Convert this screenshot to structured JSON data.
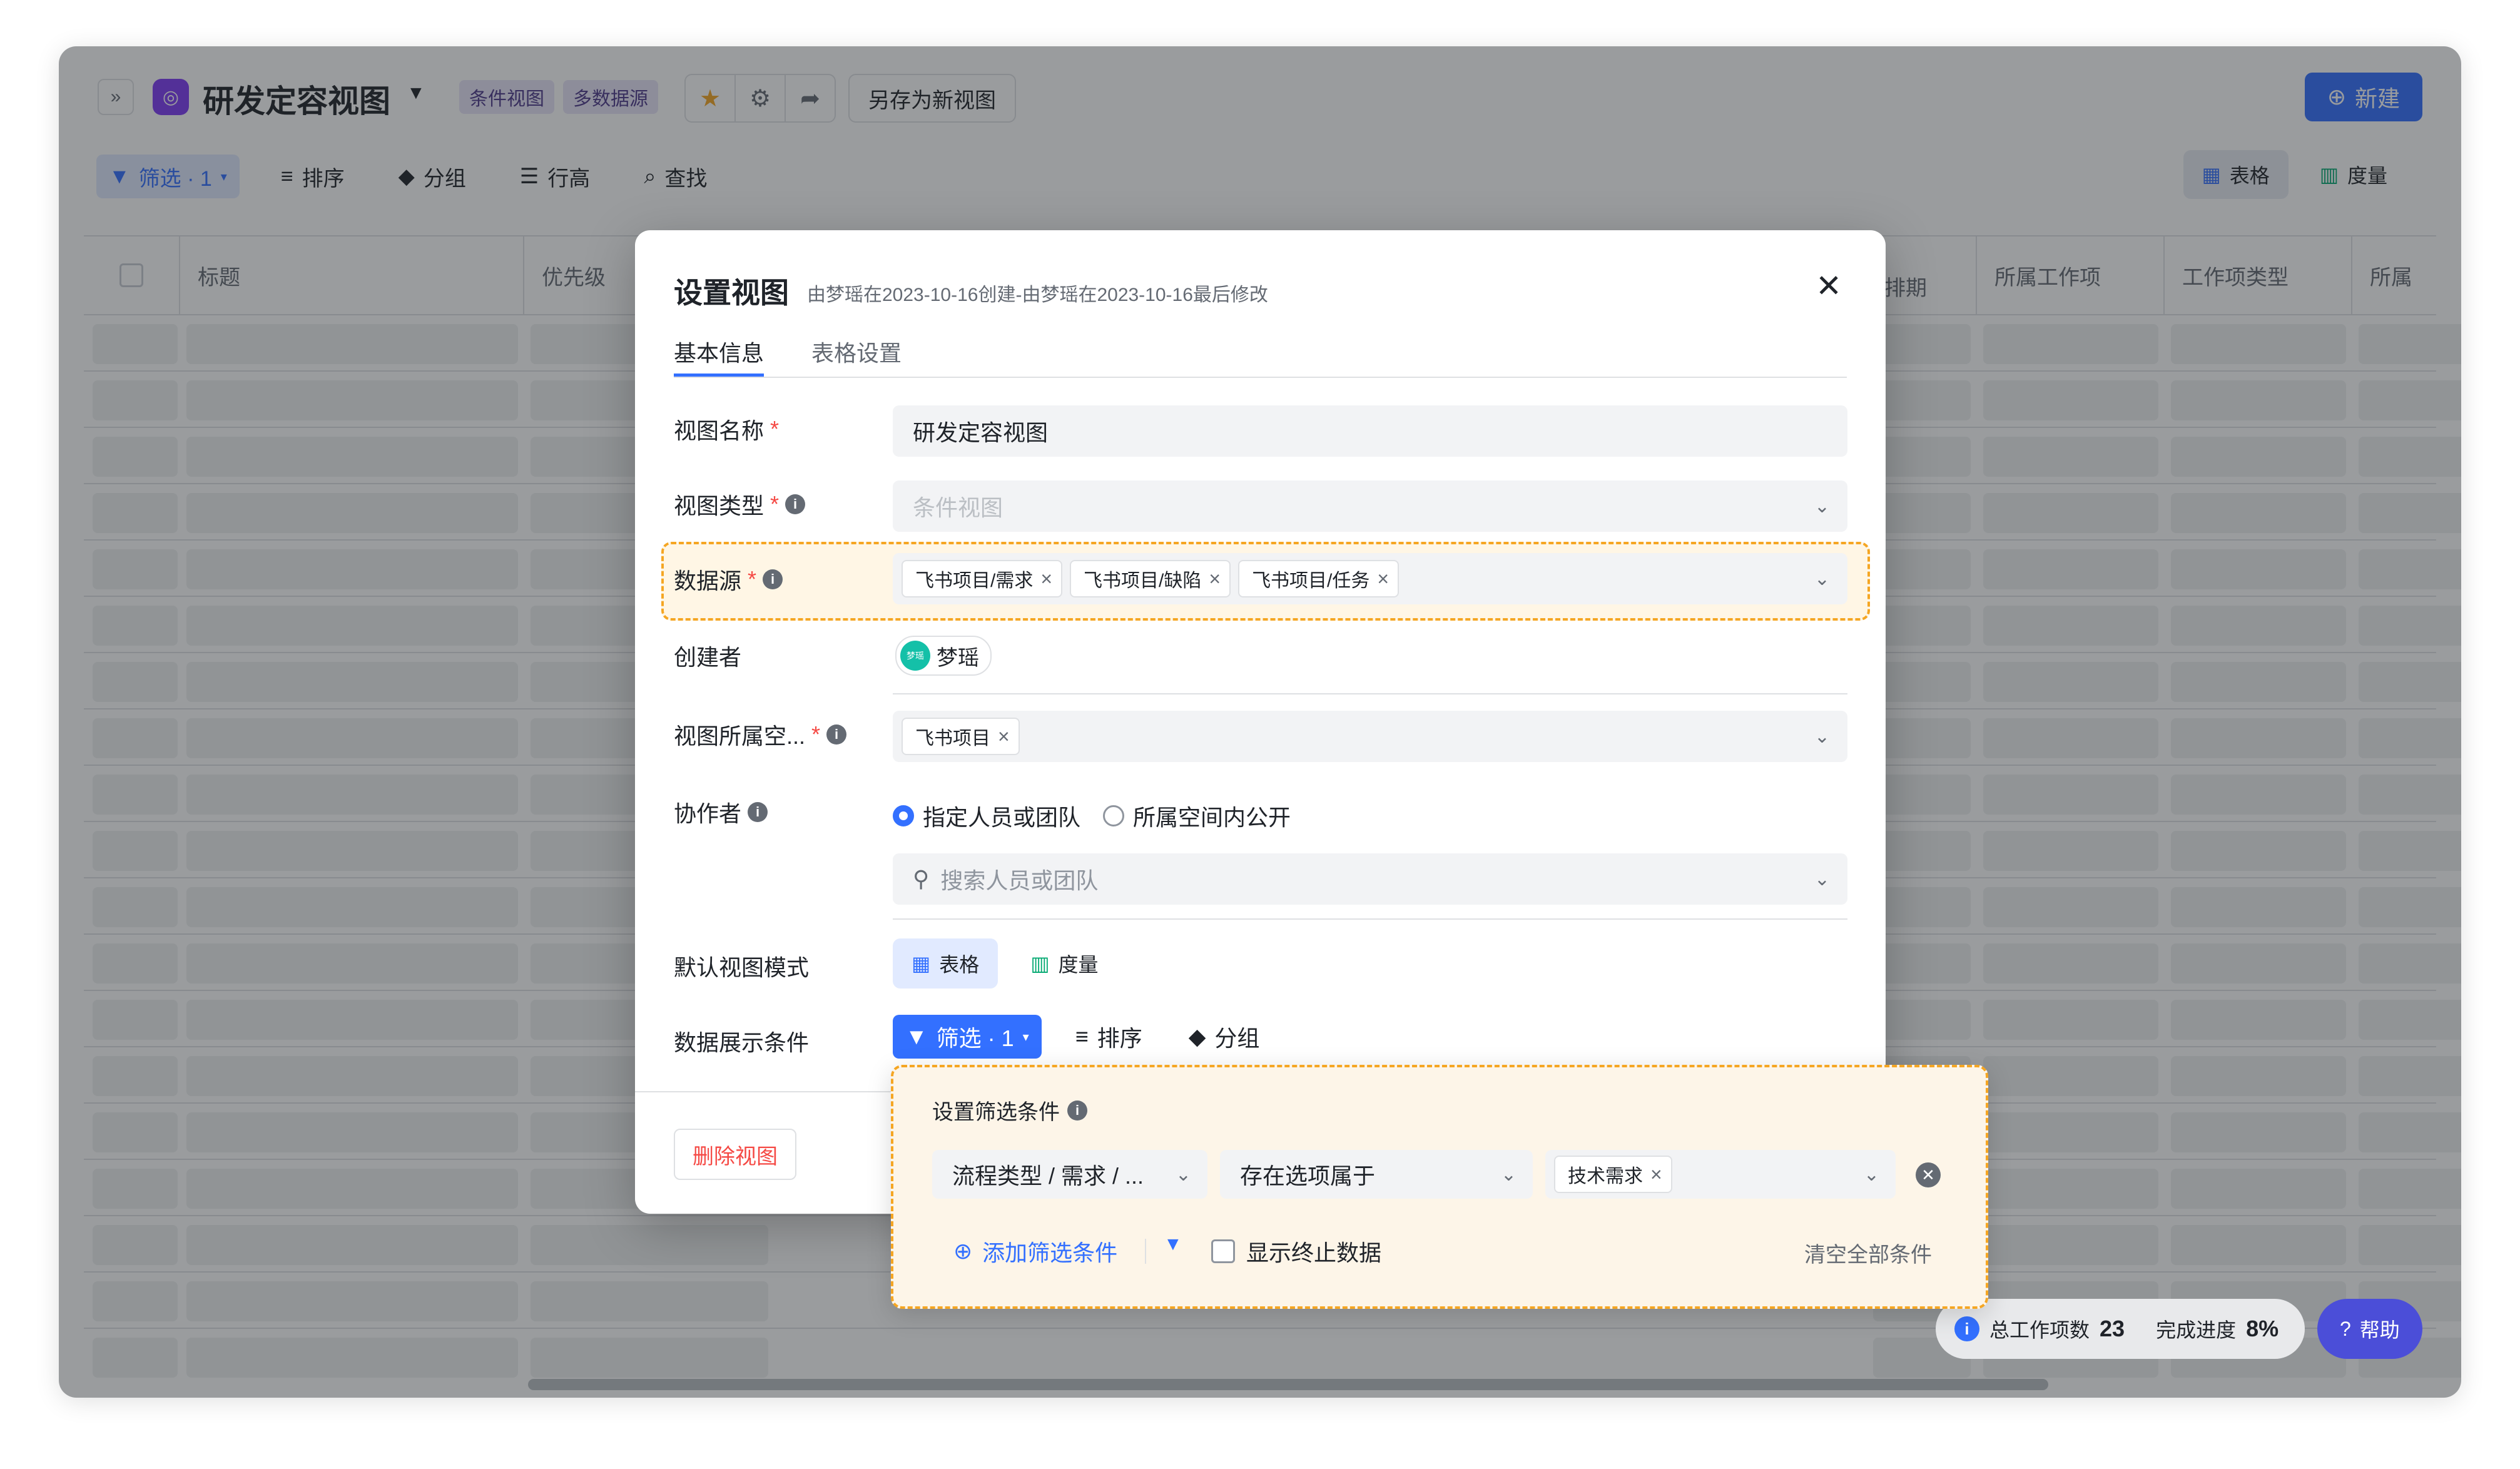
{
  "header": {
    "view_title": "研发定容视图",
    "tags": [
      "条件视图",
      "多数据源"
    ],
    "save_as_label": "另存为新视图",
    "new_label": "新建"
  },
  "toolbar": {
    "filter_label": "筛选 · 1",
    "sort_label": "排序",
    "group_label": "分组",
    "row_height_label": "行高",
    "find_label": "查找"
  },
  "view_modes": {
    "table_label": "表格",
    "metrics_label": "度量"
  },
  "table": {
    "columns": [
      "标题",
      "优先级",
      "排期",
      "所属工作项",
      "工作项类型",
      "所属"
    ]
  },
  "stats": {
    "total_label": "总工作项数",
    "total_value": "23",
    "progress_label": "完成进度",
    "progress_value": "8%"
  },
  "help_label": "帮助",
  "modal": {
    "title": "设置视图",
    "subtitle": "由梦瑶在2023-10-16创建-由梦瑶在2023-10-16最后修改",
    "tabs": [
      "基本信息",
      "表格设置"
    ],
    "fields": {
      "name_label": "视图名称",
      "name_value": "研发定容视图",
      "type_label": "视图类型",
      "type_value": "条件视图",
      "datasource_label": "数据源",
      "datasource_tags": [
        "飞书项目/需求",
        "飞书项目/缺陷",
        "飞书项目/任务"
      ],
      "creator_label": "创建者",
      "creator_name": "梦瑶",
      "creator_avatar_text": "梦瑶",
      "space_label": "视图所属空...",
      "space_tags": [
        "飞书项目"
      ],
      "collab_label": "协作者",
      "collab_option_1": "指定人员或团队",
      "collab_option_2": "所属空间内公开",
      "collab_search_placeholder": "搜索人员或团队",
      "default_mode_label": "默认视图模式",
      "default_mode_table": "表格",
      "default_mode_metrics": "度量",
      "display_cond_label": "数据展示条件",
      "cond_filter": "筛选 · 1",
      "cond_sort": "排序",
      "cond_group": "分组"
    },
    "delete_label": "删除视图"
  },
  "filter_popover": {
    "title": "设置筛选条件",
    "field_select": "流程类型 / 需求 / ...",
    "operator_select": "存在选项属于",
    "value_tags": [
      "技术需求"
    ],
    "add_label": "添加筛选条件",
    "show_terminated_label": "显示终止数据",
    "clear_all_label": "清空全部条件"
  }
}
